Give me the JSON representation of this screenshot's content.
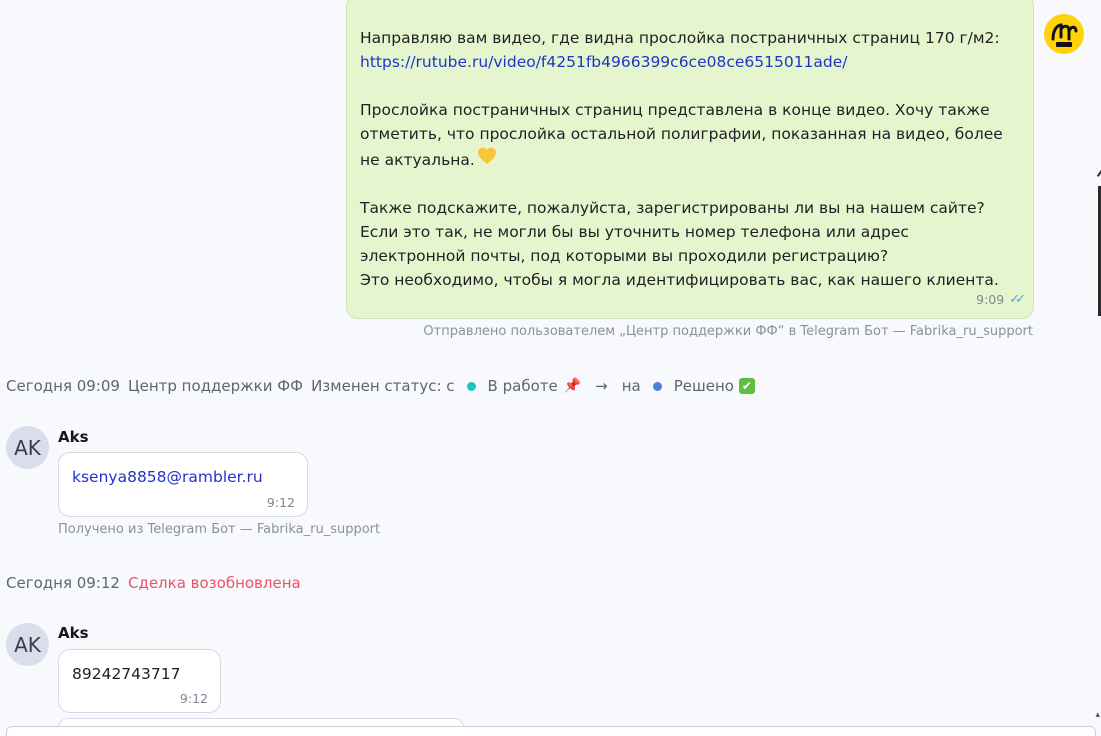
{
  "outgoing": {
    "paragraph1": "Направляю вам видео, где видна прослойка постраничных страниц 170 г/м2:",
    "link": "https://rutube.ru/video/f4251fb4966399c6ce08ce6515011ade/",
    "paragraph2": "Прослойка постраничных страниц представлена в конце видео. Хочу также отметить, что прослойка остальной полиграфии, показанная на видео, более не актуальна.",
    "paragraph3_line1": "Также подскажите, пожалуйста, зарегистрированы ли вы на нашем сайте? Если это так, не могли бы вы уточнить номер телефона или адрес электронной почты, под которыми вы проходили регистрацию?",
    "paragraph3_line2": "Это необходимо, чтобы я могла идентифицировать вас, как нашего клиента.",
    "time": "9:09",
    "heart_icon": "yellow-heart-icon",
    "status_icon": "double-check-icon",
    "sent_via": "Отправлено пользователем „Центр поддержки ФФ“ в Telegram Бот — Fabrika_ru_support"
  },
  "status_event": {
    "timestamp": "Сегодня 09:09",
    "author": "Центр поддержки ФФ",
    "action": "Изменен статус: с",
    "from_status": "В работе",
    "from_color": "#1cc3c3",
    "to_word": "на",
    "to_status": "Решено",
    "to_color": "#4d7fe0",
    "arrow": "→"
  },
  "message1": {
    "avatar": "AK",
    "sender": "Aks",
    "text": "ksenya8858@rambler.ru",
    "time": "9:12",
    "received_via": "Получено из Telegram Бот — Fabrika_ru_support"
  },
  "deal_event": {
    "timestamp": "Сегодня 09:12",
    "text": "Сделка возобновлена"
  },
  "message2": {
    "avatar": "AK",
    "sender": "Aks",
    "text": "89242743717",
    "time": "9:12"
  },
  "colors": {
    "outgoing_bg": "#e5f6cf",
    "link": "#2035c7",
    "reopened": "#e8546a",
    "bot_avatar": "#ffd20a"
  }
}
